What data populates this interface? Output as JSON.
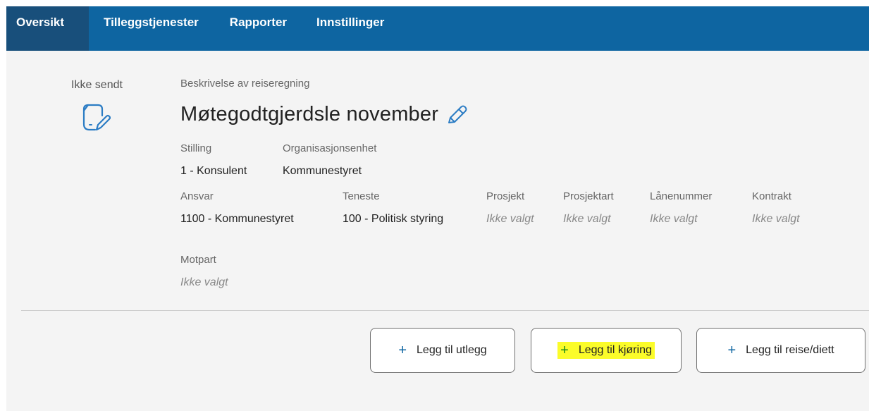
{
  "nav": {
    "items": [
      {
        "label": "Oversikt"
      },
      {
        "label": "Tilleggstjenester"
      },
      {
        "label": "Rapporter"
      },
      {
        "label": "Innstillinger"
      }
    ]
  },
  "status": {
    "label": "Ikke sendt",
    "icon": "document-edit-icon"
  },
  "description": {
    "caption": "Beskrivelse av reiseregning",
    "title": "Møtegodtgjerdsle november",
    "edit_icon": "pencil-icon"
  },
  "fields": {
    "stilling": {
      "label": "Stilling",
      "value": "1 - Konsulent"
    },
    "organisasjonsenhet": {
      "label": "Organisasjonsenhet",
      "value": "Kommunestyret"
    },
    "ansvar": {
      "label": "Ansvar",
      "value": "1100 - Kommunestyret"
    },
    "teneste": {
      "label": "Teneste",
      "value": "100 - Politisk styring"
    },
    "prosjekt": {
      "label": "Prosjekt",
      "value": "Ikke valgt"
    },
    "prosjektart": {
      "label": "Prosjektart",
      "value": "Ikke valgt"
    },
    "lanenummer": {
      "label": "Lånenummer",
      "value": "Ikke valgt"
    },
    "kontrakt": {
      "label": "Kontrakt",
      "value": "Ikke valgt"
    },
    "motpart": {
      "label": "Motpart",
      "value": "Ikke valgt"
    }
  },
  "actions": {
    "add_expense": {
      "label": "Legg til utlegg",
      "icon": "+"
    },
    "add_driving": {
      "label": "Legg til kjøring",
      "icon": "+"
    },
    "add_travel": {
      "label": "Legg til reise/diett",
      "icon": "+"
    }
  },
  "colors": {
    "nav_bg": "#0e65a1",
    "nav_active_bg": "#184f7b",
    "highlight": "#fbfc2a",
    "icon_blue": "#2b7cc4"
  }
}
